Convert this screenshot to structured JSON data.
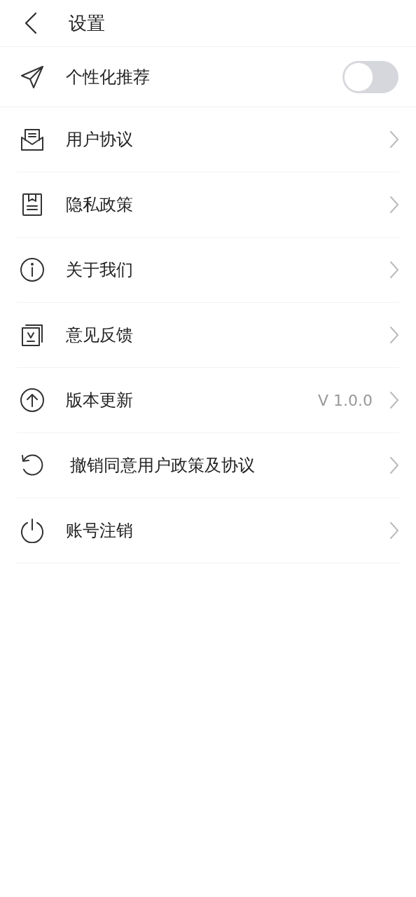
{
  "header": {
    "title": "设置"
  },
  "items": [
    {
      "kind": "toggle",
      "label": "个性化推荐",
      "on": false
    },
    {
      "kind": "link",
      "label": "用户协议"
    },
    {
      "kind": "link",
      "label": "隐私政策"
    },
    {
      "kind": "link",
      "label": "关于我们"
    },
    {
      "kind": "link",
      "label": "意见反馈"
    },
    {
      "kind": "link",
      "label": "版本更新",
      "value": "V 1.0.0"
    },
    {
      "kind": "link",
      "label": "撤销同意用户政策及协议"
    },
    {
      "kind": "link",
      "label": "账号注销"
    }
  ]
}
